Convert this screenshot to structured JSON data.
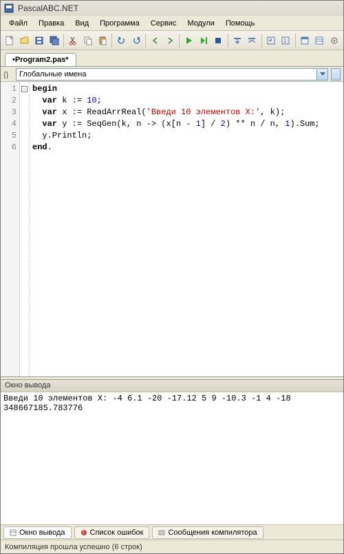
{
  "title": "PascalABC.NET",
  "menu": [
    "Файл",
    "Правка",
    "Вид",
    "Программа",
    "Сервис",
    "Модули",
    "Помощь"
  ],
  "tab": "•Program2.pas*",
  "scope_label": "Глобальные имена",
  "gutter": [
    "1",
    "2",
    "3",
    "4",
    "5",
    "6"
  ],
  "code_plain": [
    "begin",
    "  var k := 10;",
    "  var x := ReadArrReal('Введи 10 элементов X:', k);",
    "  var y := SeqGen(k, n -> (x[n - 1] / 2) ** n / n, 1).Sum;",
    "  y.Println;",
    "end."
  ],
  "output_panel_title": "Окно вывода",
  "output_lines": [
    "Введи 10 элементов X: -4 6.1 -20 -17.12 5 9 -10.3 -1 4 -18",
    "348667185.783776"
  ],
  "bottom_tabs": {
    "output": "Окно вывода",
    "errors": "Список ошибок",
    "messages": "Сообщения компилятора"
  },
  "status": "Компиляция прошла успешно (6 строк)"
}
